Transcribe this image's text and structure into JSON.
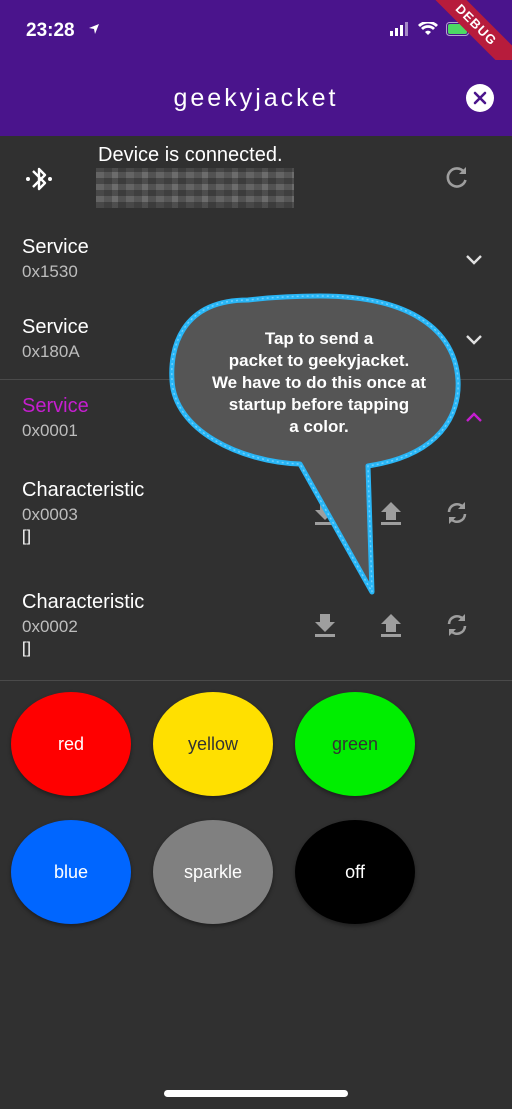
{
  "status_bar": {
    "time": "23:28",
    "debug_label": "DEBUG"
  },
  "app_bar": {
    "title": "geekyjacket"
  },
  "device": {
    "status": "Device is connected."
  },
  "services": [
    {
      "title": "Service",
      "uuid": "0x1530"
    },
    {
      "title": "Service",
      "uuid": "0x180A"
    },
    {
      "title": "Service",
      "uuid": "0x0001"
    }
  ],
  "characteristics": [
    {
      "title": "Characteristic",
      "uuid": "0x0003",
      "value": "[]"
    },
    {
      "title": "Characteristic",
      "uuid": "0x0002",
      "value": "[]"
    }
  ],
  "colors": {
    "app_bar": "#4a148c",
    "expanded_accent": "#c51ecf",
    "bubble_border": "#29b6f6",
    "bubble_fill": "#555555"
  },
  "color_buttons": [
    {
      "label": "red",
      "color": "#ff0000"
    },
    {
      "label": "yellow",
      "color": "#ffe000"
    },
    {
      "label": "green",
      "color": "#00ee00"
    },
    {
      "label": "blue",
      "color": "#0066ff"
    },
    {
      "label": "sparkle",
      "color": "#808080"
    },
    {
      "label": "off",
      "color": "#000000"
    }
  ],
  "callout": {
    "lines": [
      "Tap to send a",
      "packet to geekyjacket.",
      "We have to do this once at",
      "startup before tapping",
      "a color."
    ]
  }
}
